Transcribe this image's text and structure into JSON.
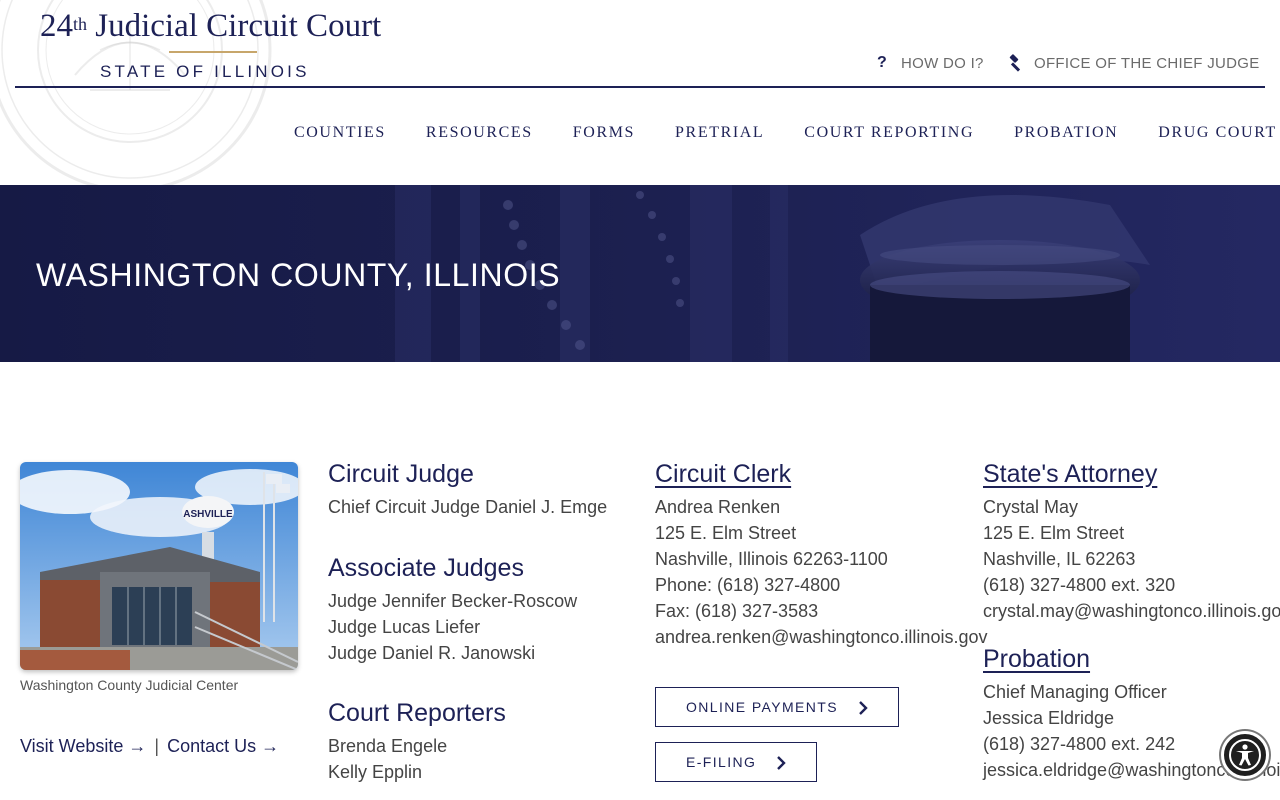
{
  "header": {
    "logo": {
      "ordinal_number": "24",
      "ordinal_suffix": "th",
      "title": "Judicial Circuit Court",
      "state": "STATE OF ILLINOIS"
    },
    "utility_links": [
      {
        "label": "HOW DO I?",
        "icon": "question-icon"
      },
      {
        "label": "OFFICE OF THE CHIEF JUDGE",
        "icon": "gavel-icon"
      }
    ],
    "nav": [
      "COUNTIES",
      "RESOURCES",
      "FORMS",
      "PRETRIAL",
      "COURT REPORTING",
      "PROBATION",
      "DRUG COURT"
    ]
  },
  "banner": {
    "title": "WASHINGTON COUNTY, ILLINOIS"
  },
  "photo": {
    "caption": "Washington County Judicial Center",
    "tower_text": "ASHVILLE"
  },
  "links": {
    "visit": "Visit Website →",
    "separator": "|",
    "contact": "Contact Us →"
  },
  "judges": {
    "circuit_heading": "Circuit Judge",
    "circuit_judge": "Chief Circuit Judge Daniel J. Emge",
    "associate_heading": "Associate Judges",
    "associates": [
      "Judge Jennifer Becker-Roscow",
      "Judge Lucas Liefer",
      "Judge Daniel R. Janowski"
    ],
    "reporters_heading": "Court Reporters",
    "reporters": [
      "Brenda Engele",
      "Kelly Epplin"
    ]
  },
  "clerk": {
    "heading": "Circuit Clerk",
    "name": "Andrea Renken",
    "street": "125 E. Elm Street",
    "city": "Nashville, Illinois 62263-1100",
    "phone": "Phone: (618) 327-4800",
    "fax": "Fax: (618) 327-3583",
    "email": "andrea.renken@washingtonco.illinois.gov",
    "buttons": [
      "ONLINE PAYMENTS",
      "E-FILING"
    ]
  },
  "attorney": {
    "heading": "State's Attorney",
    "name": "Crystal May",
    "street": "125 E. Elm Street",
    "city": "Nashville, IL 62263",
    "phone": "(618) 327-4800 ext. 320",
    "email": "crystal.may@washingtonco.illinois.gov"
  },
  "probation": {
    "heading": "Probation",
    "title": "Chief Managing Officer",
    "name": "Jessica Eldridge",
    "phone": "(618) 327-4800 ext. 242",
    "email": "jessica.eldridge@washingtonco.illinois.gov"
  },
  "colors": {
    "brand_navy": "#1d2156",
    "gold_rule": "#c7a66b",
    "banner_bg": "#1b1f4e"
  }
}
